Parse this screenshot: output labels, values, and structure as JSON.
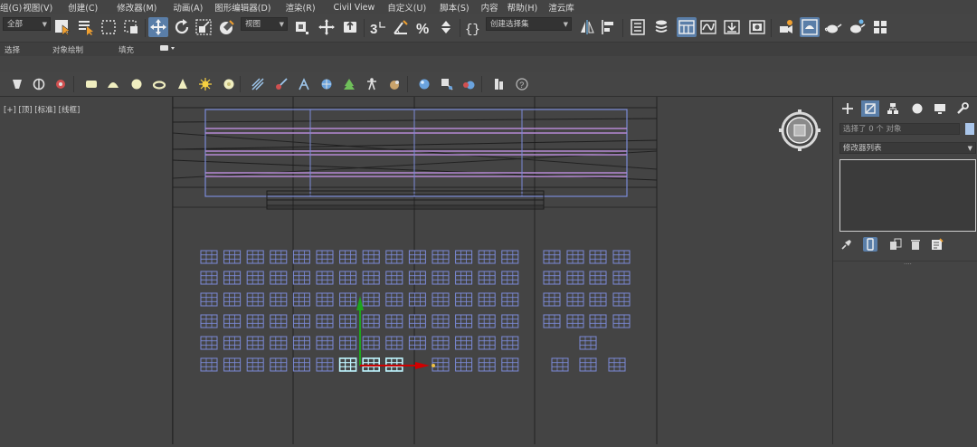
{
  "menubar": {
    "items": [
      {
        "label": "组(G)"
      },
      {
        "label": "视图(V)"
      },
      {
        "label": "创建(C)"
      },
      {
        "label": "修改器(M)"
      },
      {
        "label": "动画(A)"
      },
      {
        "label": "图形编辑器(D)"
      },
      {
        "label": "渲染(R)"
      },
      {
        "label": "Civil View"
      },
      {
        "label": "自定义(U)"
      },
      {
        "label": "脚本(S)"
      },
      {
        "label": "内容"
      },
      {
        "label": "帮助(H)"
      },
      {
        "label": "渲云库"
      }
    ]
  },
  "toolbar": {
    "filter_value": "全部",
    "view_value": "视图",
    "named_selection_placeholder": "创建选择集"
  },
  "ribbon": {
    "select_label": "选择",
    "object_paint_label": "对象绘制",
    "fill_label": "填充"
  },
  "viewport": {
    "label": "[+] [顶] [标准] [线框]"
  },
  "command_panel": {
    "selection_info_placeholder": "选择了 0 个 对象",
    "modifier_list_label": "修改器列表"
  },
  "colors": {
    "accent_active": "#5a7ea8",
    "selection_highlight": "#bff5ff",
    "wire_blue": "#7b8ad8",
    "wire_purple": "#b58ad4",
    "gizmo_x": "#d10000",
    "gizmo_y": "#1ea51e",
    "object_color": "#aac6ea"
  }
}
